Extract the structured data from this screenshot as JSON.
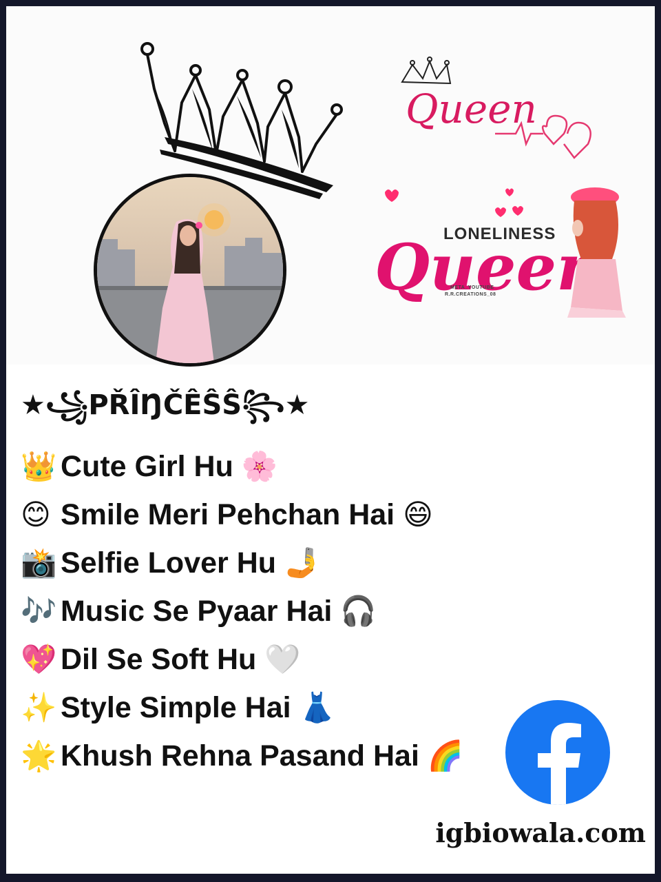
{
  "title": "★꧁PŘÎŊČÊŜŜ꧂★",
  "bio_lines": [
    {
      "emoji": "👑",
      "text": "Cute Girl Hu",
      "end_emoji": "🌸"
    },
    {
      "emoji": "😊",
      "text": "Smile Meri Pehchan Hai",
      "end_emoji": "😄"
    },
    {
      "emoji": "📸",
      "text": "Selfie Lover Hu",
      "end_emoji": "🤳"
    },
    {
      "emoji": "🎶",
      "text": "Music Se Pyaar Hai",
      "end_emoji": "🎧"
    },
    {
      "emoji": "💖",
      "text": "Dil Se Soft Hu",
      "end_emoji": "🤍"
    },
    {
      "emoji": "✨",
      "text": "Style Simple Hai",
      "end_emoji": "👗"
    },
    {
      "emoji": "🌟",
      "text": "Khush Rehna Pasand Hai",
      "end_emoji": "🌈"
    }
  ],
  "logos": {
    "queen1_word": "Queen",
    "loneliness_label": "LONELINESS",
    "queen2_word": "Queen",
    "credit_line_1": "META_YOUTUBE",
    "credit_line_2": "R.R.CREATIONS_08"
  },
  "icons": {
    "crown": "crown-icon",
    "facebook": "facebook-icon"
  },
  "site": "igbiowala.com",
  "colors": {
    "frame": "#14172a",
    "queen_pink": "#e0126e",
    "facebook_blue": "#1877f2"
  }
}
